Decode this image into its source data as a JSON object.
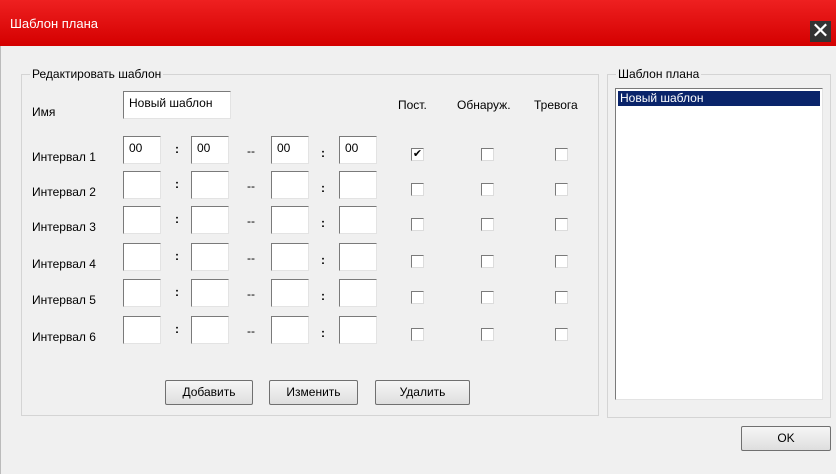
{
  "window": {
    "title": "Шаблон плана",
    "close_glyph": "✕"
  },
  "edit_group": {
    "legend": "Редактировать шаблон",
    "name_label": "Имя",
    "name_value": "Новый шаблон",
    "col_post": "Пост.",
    "col_detect": "Обнаруж.",
    "col_alarm": "Тревога",
    "colon": ":",
    "dash": "--",
    "intervals": [
      {
        "label": "Интервал 1",
        "start_h": "00",
        "start_m": "00",
        "end_h": "00",
        "end_m": "00",
        "post": true,
        "detect": false,
        "alarm": false
      },
      {
        "label": "Интервал 2",
        "start_h": "",
        "start_m": "",
        "end_h": "",
        "end_m": "",
        "post": false,
        "detect": false,
        "alarm": false
      },
      {
        "label": "Интервал 3",
        "start_h": "",
        "start_m": "",
        "end_h": "",
        "end_m": "",
        "post": false,
        "detect": false,
        "alarm": false
      },
      {
        "label": "Интервал 4",
        "start_h": "",
        "start_m": "",
        "end_h": "",
        "end_m": "",
        "post": false,
        "detect": false,
        "alarm": false
      },
      {
        "label": "Интервал 5",
        "start_h": "",
        "start_m": "",
        "end_h": "",
        "end_m": "",
        "post": false,
        "detect": false,
        "alarm": false
      },
      {
        "label": "Интервал 6",
        "start_h": "",
        "start_m": "",
        "end_h": "",
        "end_m": "",
        "post": false,
        "detect": false,
        "alarm": false
      }
    ],
    "buttons": {
      "add": "Добавить",
      "modify": "Изменить",
      "delete": "Удалить"
    }
  },
  "template_group": {
    "legend": "Шаблон плана",
    "items": [
      "Новый шаблон"
    ]
  },
  "footer": {
    "ok": "OK"
  }
}
